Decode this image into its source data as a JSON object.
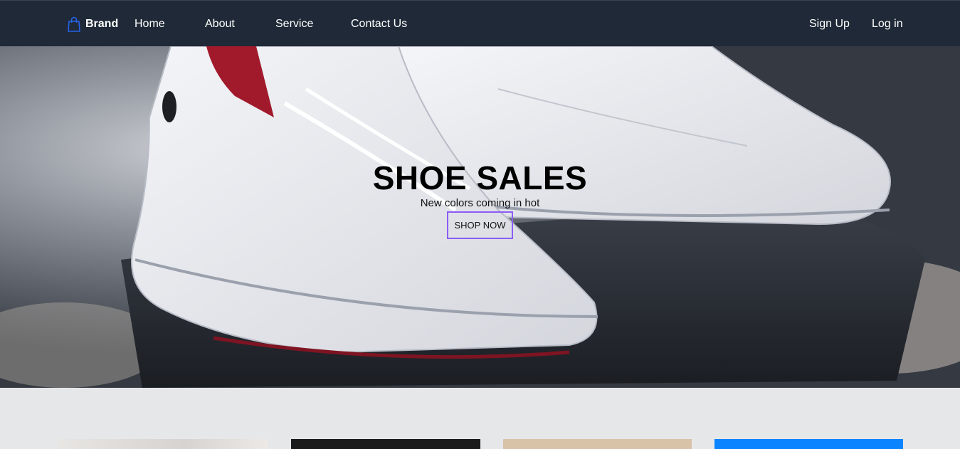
{
  "navbar": {
    "brand": "Brand",
    "links": [
      "Home",
      "About",
      "Service",
      "Contact Us"
    ],
    "signup": "Sign Up",
    "login": "Log in"
  },
  "hero": {
    "title": "SHOE SALES",
    "subtitle": "New colors coming in hot",
    "button": "SHOP NOW"
  },
  "colors": {
    "navbar_bg": "#1f2937",
    "accent": "#8b5cf6",
    "brand_icon": "#2563eb",
    "page_bg": "#e6e7e9"
  },
  "icons": {
    "brand": "shopping-bag-icon"
  }
}
